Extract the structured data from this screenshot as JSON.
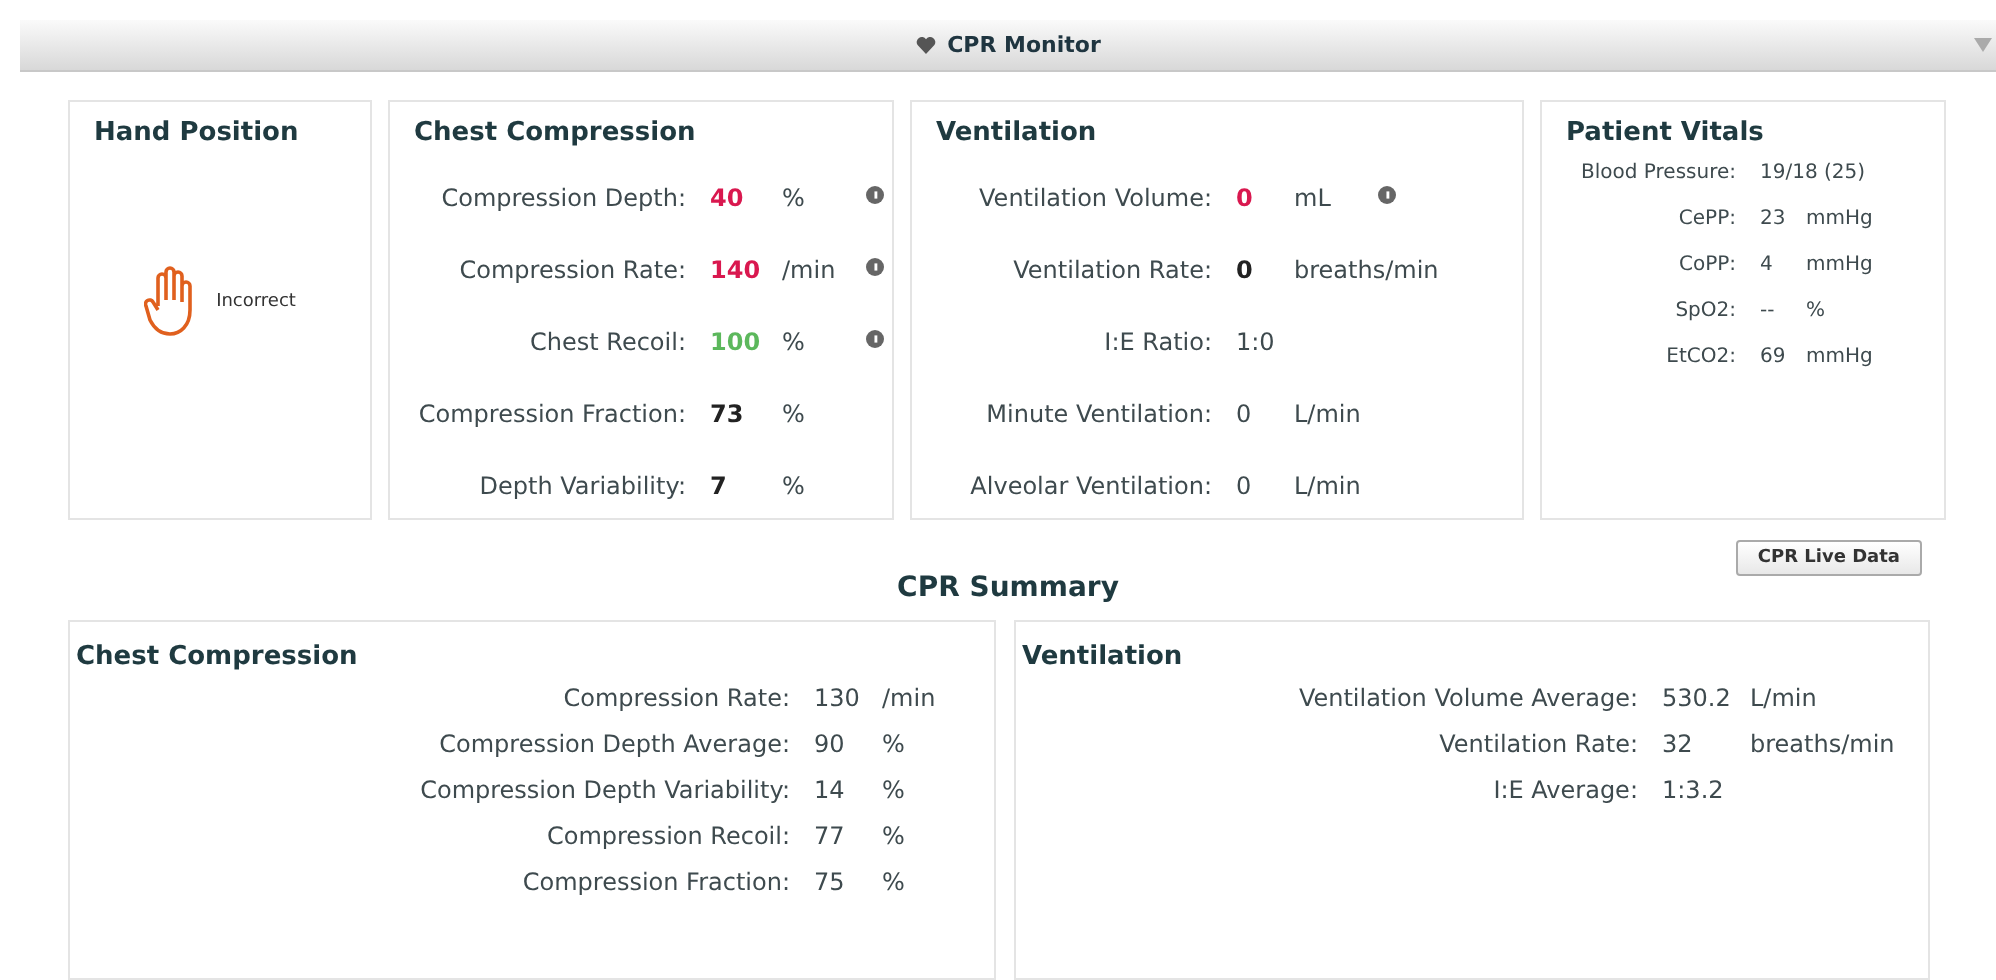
{
  "title_bar": {
    "title": "CPR Monitor"
  },
  "hand_position": {
    "title": "Hand Position",
    "status": "Incorrect",
    "correct": false
  },
  "chest_compression": {
    "title": "Chest Compression",
    "rows": [
      {
        "label": "Compression Depth:",
        "value": "40",
        "unit": "%",
        "color": "#d9184f",
        "bold": true,
        "info": true
      },
      {
        "label": "Compression Rate:",
        "value": "140",
        "unit": "/min",
        "color": "#d9184f",
        "bold": true,
        "info": true
      },
      {
        "label": "Chest Recoil:",
        "value": "100",
        "unit": "%",
        "color": "#5cb85c",
        "bold": true,
        "info": true
      },
      {
        "label": "Compression Fraction:",
        "value": "73",
        "unit": "%",
        "color": "#222222",
        "bold": true
      },
      {
        "label": "Depth Variability:",
        "value": "7",
        "unit": "%",
        "color": "#222222",
        "bold": true
      }
    ]
  },
  "ventilation": {
    "title": "Ventilation",
    "rows": [
      {
        "label": "Ventilation Volume:",
        "value": "0",
        "unit": "mL",
        "color": "#d9184f",
        "bold": true,
        "info": true
      },
      {
        "label": "Ventilation Rate:",
        "value": "0",
        "unit": "breaths/min",
        "color": "#222222",
        "bold": true
      },
      {
        "label": "I:E Ratio:",
        "value": "1:0",
        "color": "#3e4a4e",
        "bold": false
      },
      {
        "label": "Minute Ventilation:",
        "value": "0",
        "unit": "L/min",
        "color": "#3e4a4e",
        "bold": false
      },
      {
        "label": "Alveolar Ventilation:",
        "value": "0",
        "unit": "L/min",
        "color": "#3e4a4e",
        "bold": false
      }
    ]
  },
  "patient_vitals": {
    "title": "Patient Vitals",
    "rows": [
      {
        "label": "Blood Pressure:",
        "value": "19/18 (25)"
      },
      {
        "label": "CePP:",
        "value": "23",
        "unit": "mmHg"
      },
      {
        "label": "CoPP:",
        "value": "4",
        "unit": "mmHg"
      },
      {
        "label": "SpO2:",
        "value": "--",
        "unit": "%"
      },
      {
        "label": "EtCO2:",
        "value": "69",
        "unit": "mmHg"
      }
    ]
  },
  "live_data_button": "CPR Live Data",
  "summary": {
    "title": "CPR Summary",
    "panels": [
      {
        "title": "Chest Compression",
        "rows": [
          {
            "label": "Compression Rate:",
            "value": "130",
            "unit": "/min"
          },
          {
            "label": "Compression Depth Average:",
            "value": "90",
            "unit": "%"
          },
          {
            "label": "Compression Depth Variability:",
            "value": "14",
            "unit": "%"
          },
          {
            "label": "Compression Recoil:",
            "value": "77",
            "unit": "%"
          },
          {
            "label": "Compression Fraction:",
            "value": "75",
            "unit": "%"
          }
        ]
      },
      {
        "title": "Ventilation",
        "rows": [
          {
            "label": "Ventilation Volume Average:",
            "value": "530.2",
            "unit": "L/min"
          },
          {
            "label": "Ventilation Rate:",
            "value": "32",
            "unit": "breaths/min"
          },
          {
            "label": "I:E Average:",
            "value": "1:3.2"
          }
        ]
      }
    ]
  }
}
